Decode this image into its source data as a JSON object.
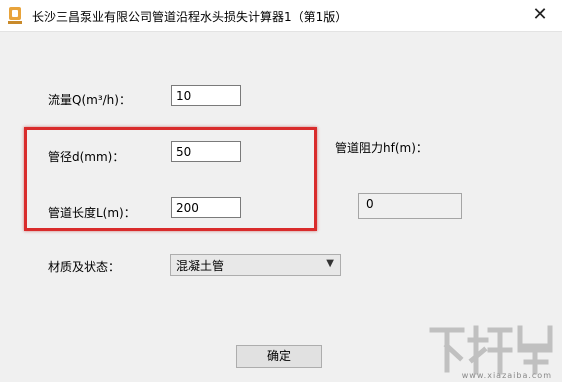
{
  "window": {
    "title": "长沙三昌泵业有限公司管道沿程水头损失计算器1（第1版）",
    "close_glyph": "✕",
    "app_icon": "pump-logo-icon",
    "brand_color": "#e8a33b"
  },
  "form": {
    "flow_label": "流量Q(m³/h)：",
    "flow_value": "10",
    "diameter_label": "管径d(mm)：",
    "diameter_value": "50",
    "length_label": "管道长度L(m)：",
    "length_value": "200",
    "material_label": "材质及状态：",
    "material_value": "混凝土管"
  },
  "result": {
    "label": "管道阻力hf(m)：",
    "value": "0"
  },
  "buttons": {
    "ok_label": "确定"
  },
  "annotation": {
    "highlight_color": "#d92b2b"
  },
  "watermark": {
    "text": "下载吧",
    "url": "www.xiazaiba.com"
  }
}
